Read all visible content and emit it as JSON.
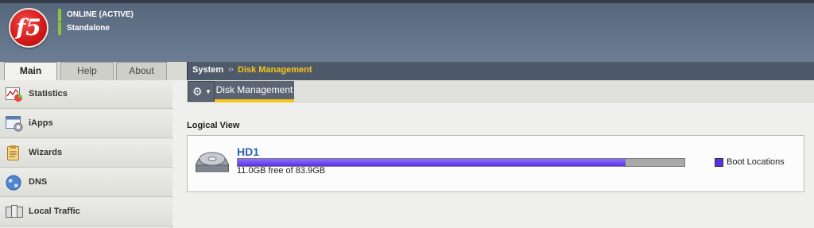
{
  "header": {
    "logo_text": "f5",
    "status_online": "ONLINE (ACTIVE)",
    "status_mode": "Standalone",
    "status_color": "#8cc43c"
  },
  "tabs": [
    {
      "label": "Main",
      "active": true
    },
    {
      "label": "Help",
      "active": false
    },
    {
      "label": "About",
      "active": false
    }
  ],
  "sidebar": {
    "items": [
      {
        "label": "Statistics",
        "icon": "statistics-icon"
      },
      {
        "label": "iApps",
        "icon": "iapps-icon"
      },
      {
        "label": "Wizards",
        "icon": "wizards-icon"
      },
      {
        "label": "DNS",
        "icon": "dns-globe-icon"
      },
      {
        "label": "Local Traffic",
        "icon": "local-traffic-icon"
      }
    ]
  },
  "breadcrumb": {
    "root": "System",
    "separator": "››",
    "current": "Disk Management"
  },
  "toolbar": {
    "gear_icon": "gear-icon",
    "active_tab": "Disk Management"
  },
  "logical_view": {
    "title": "Logical View",
    "disk": {
      "name": "HD1",
      "usage_text": "11.0GB free of 83.9GB",
      "used_fraction": 0.869
    },
    "legend": {
      "label": "Boot Locations",
      "color": "#5a30e6"
    }
  },
  "colors": {
    "accent_yellow": "#f8c61a",
    "brand_red": "#d51a1a",
    "link_blue": "#2c5fb8"
  }
}
